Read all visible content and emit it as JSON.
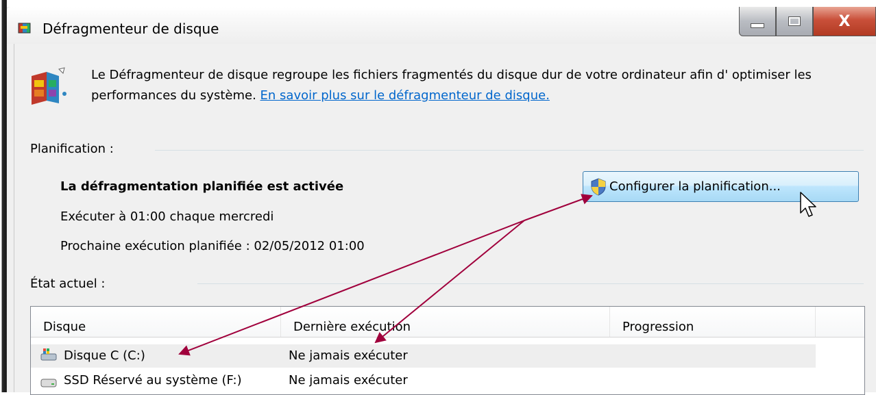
{
  "window": {
    "title": "Défragmenteur de disque",
    "close_glyph": "X"
  },
  "description": {
    "text": "Le Défragmenteur de disque regroupe les fichiers fragmentés du disque dur de votre ordinateur afin d' optimiser les performances du système.",
    "link": "En savoir plus sur le défragmenteur de disque."
  },
  "schedule": {
    "section_label": "Planification :",
    "status": "La défragmentation planifiée est activée",
    "run_at": "Exécuter à 01:00 chaque mercredi",
    "next_run": "Prochaine exécution planifiée : 02/05/2012 01:00",
    "configure_button": "Configurer la planification..."
  },
  "current_state": {
    "section_label": "État actuel :",
    "columns": [
      "Disque",
      "Dernière exécution",
      "Progression"
    ],
    "rows": [
      {
        "disk": "Disque C (C:)",
        "last_run": "Ne jamais exécuter",
        "progress": ""
      },
      {
        "disk": "SSD Réservé au système (F:)",
        "last_run": "Ne jamais exécuter",
        "progress": ""
      }
    ]
  },
  "colors": {
    "link": "#0066cc",
    "annotation_arrow": "#a0003c",
    "button_border": "#3c7fb1"
  },
  "icons": {
    "title": "defrag-icon",
    "header": "defrag-icon",
    "button": "uac-shield-icon",
    "row_0": "system-drive-icon",
    "row_1": "drive-icon",
    "cursor": "mouse-pointer-icon"
  }
}
